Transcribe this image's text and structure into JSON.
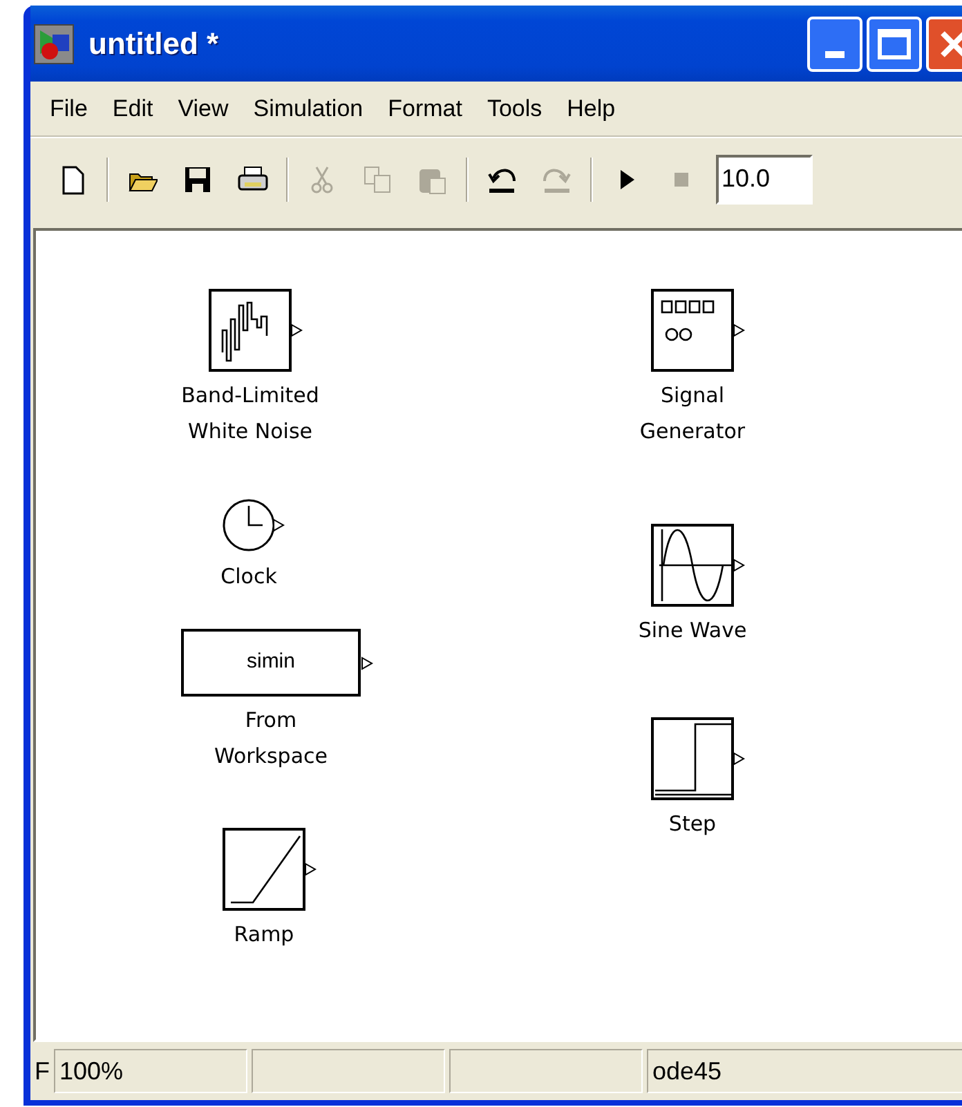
{
  "window": {
    "title": "untitled *"
  },
  "menu": [
    "File",
    "Edit",
    "View",
    "Simulation",
    "Format",
    "Tools",
    "Help"
  ],
  "toolbar": [
    {
      "kind": "new",
      "disabled": false
    },
    {
      "kind": "sep"
    },
    {
      "kind": "open",
      "disabled": false
    },
    {
      "kind": "save",
      "disabled": false
    },
    {
      "kind": "print",
      "disabled": false
    },
    {
      "kind": "sep"
    },
    {
      "kind": "cut",
      "disabled": true
    },
    {
      "kind": "copy",
      "disabled": true
    },
    {
      "kind": "paste",
      "disabled": true
    },
    {
      "kind": "sep"
    },
    {
      "kind": "undo",
      "disabled": false
    },
    {
      "kind": "redo",
      "disabled": true
    },
    {
      "kind": "sep"
    },
    {
      "kind": "run",
      "disabled": false
    },
    {
      "kind": "stop",
      "disabled": true
    }
  ],
  "stop_time": {
    "value": "10.0"
  },
  "blocks": [
    {
      "kind": "noise",
      "label": [
        "Band-Limited",
        "White Noise"
      ]
    },
    {
      "kind": "siggen",
      "label": [
        "Signal",
        "Generator"
      ]
    },
    {
      "kind": "clock",
      "label": [
        "Clock"
      ]
    },
    {
      "kind": "sine",
      "label": [
        "Sine Wave"
      ]
    },
    {
      "kind": "workspace",
      "text": "simin",
      "label": [
        "From",
        "Workspace"
      ]
    },
    {
      "kind": "step",
      "label": [
        "Step"
      ]
    },
    {
      "kind": "ramp",
      "label": [
        "Ramp"
      ]
    }
  ],
  "status_bar": {
    "cut_text": "F",
    "zoom": "100%",
    "solver": "ode45"
  }
}
